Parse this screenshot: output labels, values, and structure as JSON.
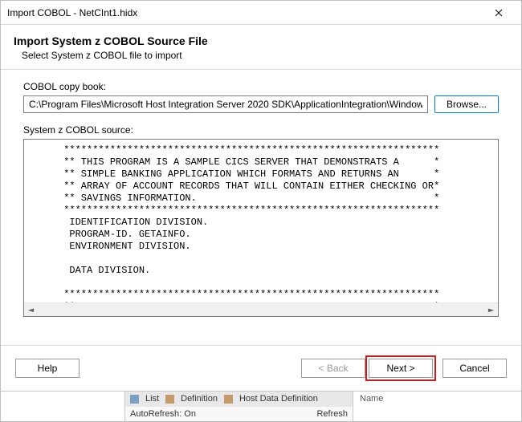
{
  "window": {
    "title": "Import COBOL - NetCInt1.hidx"
  },
  "header": {
    "title": "Import System z COBOL Source File",
    "subtitle": "Select System z COBOL file to import"
  },
  "form": {
    "copybook_label": "COBOL copy book:",
    "copybook_value": "C:\\Program Files\\Microsoft Host Integration Server 2020 SDK\\ApplicationIntegration\\WindowsInitiated\\Cics",
    "browse_label": "Browse...",
    "source_label": "System z COBOL source:",
    "source_text": "      *****************************************************************\n      ** THIS PROGRAM IS A SAMPLE CICS SERVER THAT DEMONSTRATS A      *\n      ** SIMPLE BANKING APPLICATION WHICH FORMATS AND RETURNS AN      *\n      ** ARRAY OF ACCOUNT RECORDS THAT WILL CONTAIN EITHER CHECKING OR*\n      ** SAVINGS INFORMATION.                                         *\n      *****************************************************************\n       IDENTIFICATION DIVISION.\n       PROGRAM-ID. GETAINFO.\n       ENVIRONMENT DIVISION.\n\n       DATA DIVISION.\n\n      *****************************************************************\n      ** VARIABLES FOR INTERACTING WITH THE TERMINAL SESSION          *"
  },
  "buttons": {
    "help": "Help",
    "back": "< Back",
    "next": "Next >",
    "cancel": "Cancel"
  },
  "background_ui": {
    "list_label": "List",
    "definition_label": "Definition",
    "host_def_label": "Host Data Definition",
    "autorefresh_label": "AutoRefresh: On",
    "refresh_label": "Refresh",
    "name_label": "Name"
  }
}
